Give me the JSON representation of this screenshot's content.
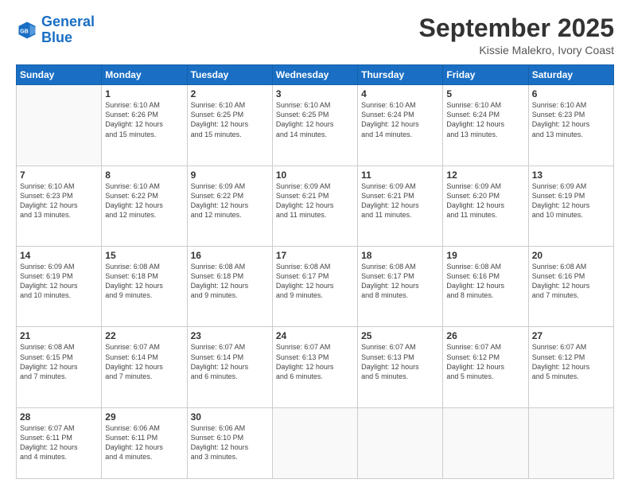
{
  "header": {
    "logo_line1": "General",
    "logo_line2": "Blue",
    "month": "September 2025",
    "location": "Kissie Malekro, Ivory Coast"
  },
  "weekdays": [
    "Sunday",
    "Monday",
    "Tuesday",
    "Wednesday",
    "Thursday",
    "Friday",
    "Saturday"
  ],
  "rows": [
    [
      {
        "day": "",
        "info": ""
      },
      {
        "day": "1",
        "info": "Sunrise: 6:10 AM\nSunset: 6:26 PM\nDaylight: 12 hours\nand 15 minutes."
      },
      {
        "day": "2",
        "info": "Sunrise: 6:10 AM\nSunset: 6:25 PM\nDaylight: 12 hours\nand 15 minutes."
      },
      {
        "day": "3",
        "info": "Sunrise: 6:10 AM\nSunset: 6:25 PM\nDaylight: 12 hours\nand 14 minutes."
      },
      {
        "day": "4",
        "info": "Sunrise: 6:10 AM\nSunset: 6:24 PM\nDaylight: 12 hours\nand 14 minutes."
      },
      {
        "day": "5",
        "info": "Sunrise: 6:10 AM\nSunset: 6:24 PM\nDaylight: 12 hours\nand 13 minutes."
      },
      {
        "day": "6",
        "info": "Sunrise: 6:10 AM\nSunset: 6:23 PM\nDaylight: 12 hours\nand 13 minutes."
      }
    ],
    [
      {
        "day": "7",
        "info": "Sunrise: 6:10 AM\nSunset: 6:23 PM\nDaylight: 12 hours\nand 13 minutes."
      },
      {
        "day": "8",
        "info": "Sunrise: 6:10 AM\nSunset: 6:22 PM\nDaylight: 12 hours\nand 12 minutes."
      },
      {
        "day": "9",
        "info": "Sunrise: 6:09 AM\nSunset: 6:22 PM\nDaylight: 12 hours\nand 12 minutes."
      },
      {
        "day": "10",
        "info": "Sunrise: 6:09 AM\nSunset: 6:21 PM\nDaylight: 12 hours\nand 11 minutes."
      },
      {
        "day": "11",
        "info": "Sunrise: 6:09 AM\nSunset: 6:21 PM\nDaylight: 12 hours\nand 11 minutes."
      },
      {
        "day": "12",
        "info": "Sunrise: 6:09 AM\nSunset: 6:20 PM\nDaylight: 12 hours\nand 11 minutes."
      },
      {
        "day": "13",
        "info": "Sunrise: 6:09 AM\nSunset: 6:19 PM\nDaylight: 12 hours\nand 10 minutes."
      }
    ],
    [
      {
        "day": "14",
        "info": "Sunrise: 6:09 AM\nSunset: 6:19 PM\nDaylight: 12 hours\nand 10 minutes."
      },
      {
        "day": "15",
        "info": "Sunrise: 6:08 AM\nSunset: 6:18 PM\nDaylight: 12 hours\nand 9 minutes."
      },
      {
        "day": "16",
        "info": "Sunrise: 6:08 AM\nSunset: 6:18 PM\nDaylight: 12 hours\nand 9 minutes."
      },
      {
        "day": "17",
        "info": "Sunrise: 6:08 AM\nSunset: 6:17 PM\nDaylight: 12 hours\nand 9 minutes."
      },
      {
        "day": "18",
        "info": "Sunrise: 6:08 AM\nSunset: 6:17 PM\nDaylight: 12 hours\nand 8 minutes."
      },
      {
        "day": "19",
        "info": "Sunrise: 6:08 AM\nSunset: 6:16 PM\nDaylight: 12 hours\nand 8 minutes."
      },
      {
        "day": "20",
        "info": "Sunrise: 6:08 AM\nSunset: 6:16 PM\nDaylight: 12 hours\nand 7 minutes."
      }
    ],
    [
      {
        "day": "21",
        "info": "Sunrise: 6:08 AM\nSunset: 6:15 PM\nDaylight: 12 hours\nand 7 minutes."
      },
      {
        "day": "22",
        "info": "Sunrise: 6:07 AM\nSunset: 6:14 PM\nDaylight: 12 hours\nand 7 minutes."
      },
      {
        "day": "23",
        "info": "Sunrise: 6:07 AM\nSunset: 6:14 PM\nDaylight: 12 hours\nand 6 minutes."
      },
      {
        "day": "24",
        "info": "Sunrise: 6:07 AM\nSunset: 6:13 PM\nDaylight: 12 hours\nand 6 minutes."
      },
      {
        "day": "25",
        "info": "Sunrise: 6:07 AM\nSunset: 6:13 PM\nDaylight: 12 hours\nand 5 minutes."
      },
      {
        "day": "26",
        "info": "Sunrise: 6:07 AM\nSunset: 6:12 PM\nDaylight: 12 hours\nand 5 minutes."
      },
      {
        "day": "27",
        "info": "Sunrise: 6:07 AM\nSunset: 6:12 PM\nDaylight: 12 hours\nand 5 minutes."
      }
    ],
    [
      {
        "day": "28",
        "info": "Sunrise: 6:07 AM\nSunset: 6:11 PM\nDaylight: 12 hours\nand 4 minutes."
      },
      {
        "day": "29",
        "info": "Sunrise: 6:06 AM\nSunset: 6:11 PM\nDaylight: 12 hours\nand 4 minutes."
      },
      {
        "day": "30",
        "info": "Sunrise: 6:06 AM\nSunset: 6:10 PM\nDaylight: 12 hours\nand 3 minutes."
      },
      {
        "day": "",
        "info": ""
      },
      {
        "day": "",
        "info": ""
      },
      {
        "day": "",
        "info": ""
      },
      {
        "day": "",
        "info": ""
      }
    ]
  ]
}
